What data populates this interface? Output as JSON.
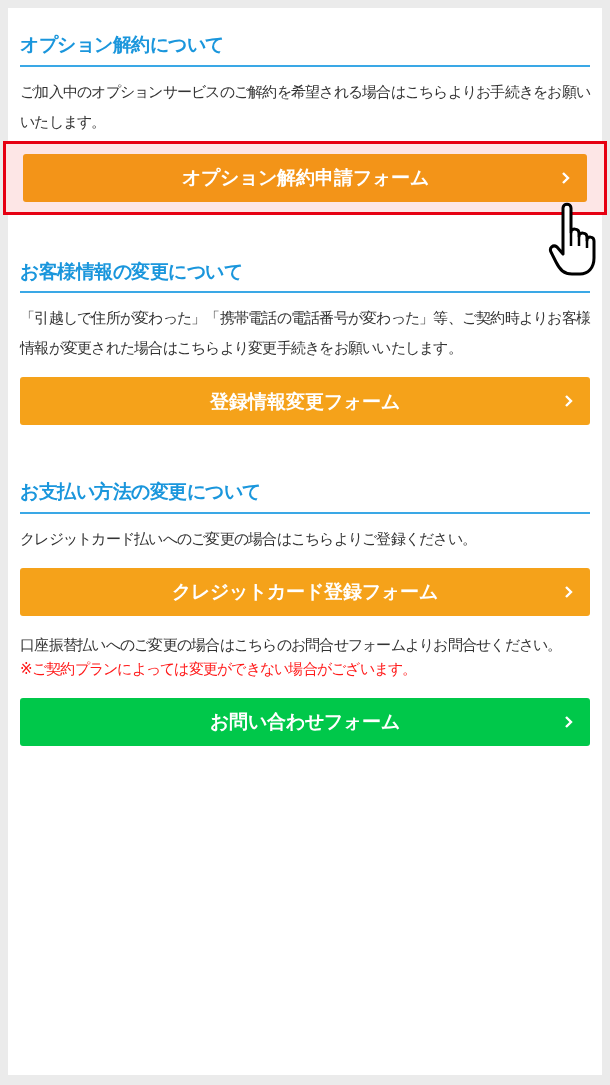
{
  "sections": [
    {
      "heading": "オプション解約について",
      "blocks": [
        {
          "kind": "text",
          "text": "ご加入中のオプションサービスのご解約を希望される場合はこちらよりお手続きをお願いいたします。"
        },
        {
          "kind": "button",
          "label": "オプション解約申請フォーム",
          "color": "#f39418",
          "highlighted": true
        }
      ]
    },
    {
      "heading": "お客様情報の変更について",
      "blocks": [
        {
          "kind": "text",
          "text": "「引越しで住所が変わった」「携帯電話の電話番号が変わった」等、ご契約時よりお客様情報が変更された場合はこちらより変更手続きをお願いいたします。"
        },
        {
          "kind": "button",
          "label": "登録情報変更フォーム",
          "color": "#f5a21a",
          "highlighted": false
        }
      ]
    },
    {
      "heading": "お支払い方法の変更について",
      "blocks": [
        {
          "kind": "text",
          "text": "クレジットカード払いへのご変更の場合はこちらよりご登録ください。"
        },
        {
          "kind": "button",
          "label": "クレジットカード登録フォーム",
          "color": "#f5a21a",
          "highlighted": false
        },
        {
          "kind": "text",
          "text": "口座振替払いへのご変更の場合はこちらのお問合せフォームよりお問合せください。"
        },
        {
          "kind": "note",
          "text": "※ご契約プランによっては変更ができない場合がございます。"
        },
        {
          "kind": "button",
          "label": "お問い合わせフォーム",
          "color": "#00c84a",
          "highlighted": false
        }
      ]
    }
  ]
}
